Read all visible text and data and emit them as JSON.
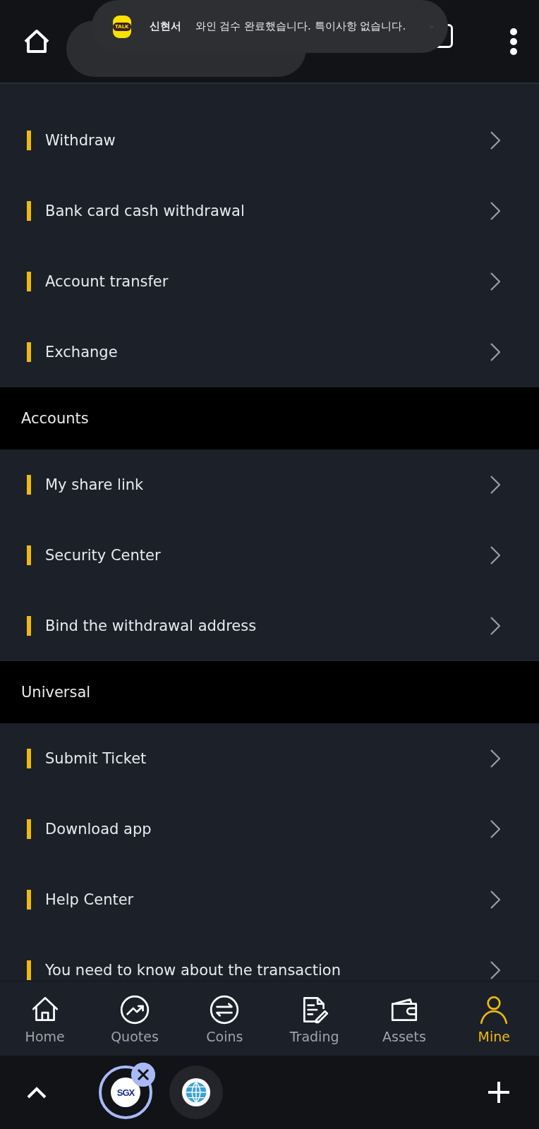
{
  "notification": {
    "app_icon_label": "TALK",
    "sender": "신현서",
    "message": "와인 검수 완료했습니다. 특이사항 없습니다."
  },
  "sections": [
    {
      "items": [
        {
          "label": "Withdraw"
        },
        {
          "label": "Bank card cash withdrawal"
        },
        {
          "label": "Account transfer"
        },
        {
          "label": "Exchange"
        }
      ]
    },
    {
      "title": "Accounts",
      "items": [
        {
          "label": "My share link"
        },
        {
          "label": "Security Center"
        },
        {
          "label": "Bind the withdrawal address"
        }
      ]
    },
    {
      "title": "Universal",
      "items": [
        {
          "label": "Submit Ticket"
        },
        {
          "label": "Download app"
        },
        {
          "label": "Help Center"
        },
        {
          "label": "You need to know about the transaction"
        }
      ]
    }
  ],
  "bottom_nav": [
    {
      "kind": "home",
      "label": "Home",
      "selected": false
    },
    {
      "kind": "quotes",
      "label": "Quotes",
      "selected": false
    },
    {
      "kind": "coins",
      "label": "Coins",
      "selected": false
    },
    {
      "kind": "trading",
      "label": "Trading",
      "selected": false
    },
    {
      "kind": "assets",
      "label": "Assets",
      "selected": false
    },
    {
      "kind": "mine",
      "label": "Mine",
      "selected": true
    }
  ],
  "browser_tabs": [
    {
      "kind": "logo",
      "label": "SGX",
      "selected": true
    },
    {
      "kind": "globe",
      "selected": false
    }
  ]
}
